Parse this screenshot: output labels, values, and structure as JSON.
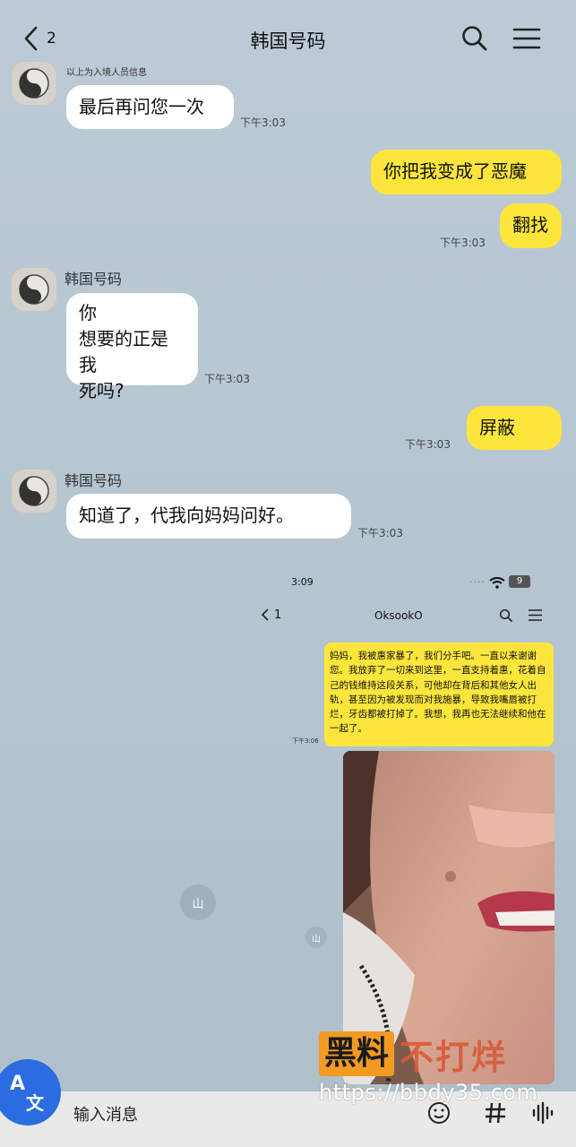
{
  "header": {
    "back_count": "2",
    "title": "韩国号码"
  },
  "chat": {
    "sys_note": "以上为入境人员信息",
    "messages": [
      {
        "text": "最后再问您一次",
        "time": "下午3:03"
      },
      {
        "text": "你把我变成了恶魔"
      },
      {
        "text": "翻找",
        "time": "下午3:03"
      },
      {
        "sender": "韩国号码",
        "text_lines": [
          "你",
          "想要的正是我",
          "死吗?"
        ],
        "time": "下午3:03"
      },
      {
        "text": "屏蔽",
        "time": "下午3:03"
      },
      {
        "sender": "韩国号码",
        "text": "知道了，代我向妈妈问好。",
        "time": "下午3:03"
      }
    ]
  },
  "embedded": {
    "status_time": "3:09",
    "status_dots": "....",
    "battery": "9",
    "back_count": "1",
    "title": "OksookO",
    "message": "妈妈，我被惠家暴了，我们分手吧。一直以来谢谢您。我放弃了一切来到这里，一直支持着惠，花着自己的钱维持这段关系，可他却在背后和其他女人出轨，甚至因为被发现而对我施暴，导致我嘴唇被打烂，牙齿都被打掉了。我想，我再也无法继续和他在一起了。",
    "time": "下午3:06",
    "chip_label": "山"
  },
  "overlay": {
    "chip_label": "山",
    "watermark_a": "黑料",
    "watermark_b": "不打烊",
    "watermark_url": "https://bbdy35.com"
  },
  "bottom": {
    "translate_top": "A",
    "translate_bottom": "文",
    "input_placeholder": "输入消息"
  }
}
